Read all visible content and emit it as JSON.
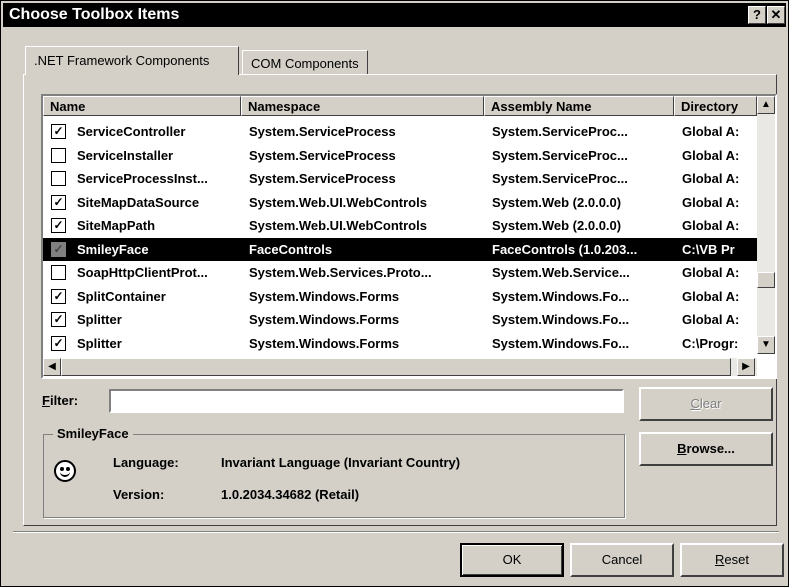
{
  "window": {
    "title": "Choose Toolbox Items",
    "help_label": "?",
    "close_label": "✕"
  },
  "tabs": [
    ".NET Framework Components",
    "COM Components"
  ],
  "list": {
    "columns": [
      "Name",
      "Namespace",
      "Assembly Name",
      "Directory"
    ],
    "rows": [
      {
        "checked": true,
        "name": "ServiceController",
        "namespace": "System.ServiceProcess",
        "assembly": "System.ServiceProc...",
        "directory": "Global A:"
      },
      {
        "checked": false,
        "name": "ServiceInstaller",
        "namespace": "System.ServiceProcess",
        "assembly": "System.ServiceProc...",
        "directory": "Global A:"
      },
      {
        "checked": false,
        "name": "ServiceProcessInst...",
        "namespace": "System.ServiceProcess",
        "assembly": "System.ServiceProc...",
        "directory": "Global A:"
      },
      {
        "checked": true,
        "name": "SiteMapDataSource",
        "namespace": "System.Web.UI.WebControls",
        "assembly": "System.Web (2.0.0.0)",
        "directory": "Global A:"
      },
      {
        "checked": true,
        "name": "SiteMapPath",
        "namespace": "System.Web.UI.WebControls",
        "assembly": "System.Web (2.0.0.0)",
        "directory": "Global A:"
      },
      {
        "checked": true,
        "name": "SmileyFace",
        "namespace": "FaceControls",
        "assembly": "FaceControls (1.0.203...",
        "directory": "C:\\VB Pr",
        "selected": true
      },
      {
        "checked": false,
        "name": "SoapHttpClientProt...",
        "namespace": "System.Web.Services.Proto...",
        "assembly": "System.Web.Service...",
        "directory": "Global A:"
      },
      {
        "checked": true,
        "name": "SplitContainer",
        "namespace": "System.Windows.Forms",
        "assembly": "System.Windows.Fo...",
        "directory": "Global A:"
      },
      {
        "checked": true,
        "name": "Splitter",
        "namespace": "System.Windows.Forms",
        "assembly": "System.Windows.Fo...",
        "directory": "Global A:"
      },
      {
        "checked": true,
        "name": "Splitter",
        "namespace": "System.Windows.Forms",
        "assembly": "System.Windows.Fo...",
        "directory": "C:\\Progr:"
      }
    ]
  },
  "filter": {
    "label_prefix": "",
    "label_access": "F",
    "label_rest": "ilter:",
    "value": ""
  },
  "buttons": {
    "clear_access": "C",
    "clear_rest": "lear",
    "browse_access": "B",
    "browse_rest": "rowse...",
    "ok": "OK",
    "cancel": "Cancel",
    "reset_access": "R",
    "reset_rest": "eset"
  },
  "details": {
    "name": "SmileyFace",
    "language_label": "Language:",
    "language_value": "Invariant Language (Invariant Country)",
    "version_label": "Version:",
    "version_value": "1.0.2034.34682 (Retail)",
    "icon": "smiley-face-icon"
  },
  "scroll_icons": {
    "up": "▲",
    "down": "▼",
    "left": "◀",
    "right": "▶"
  }
}
